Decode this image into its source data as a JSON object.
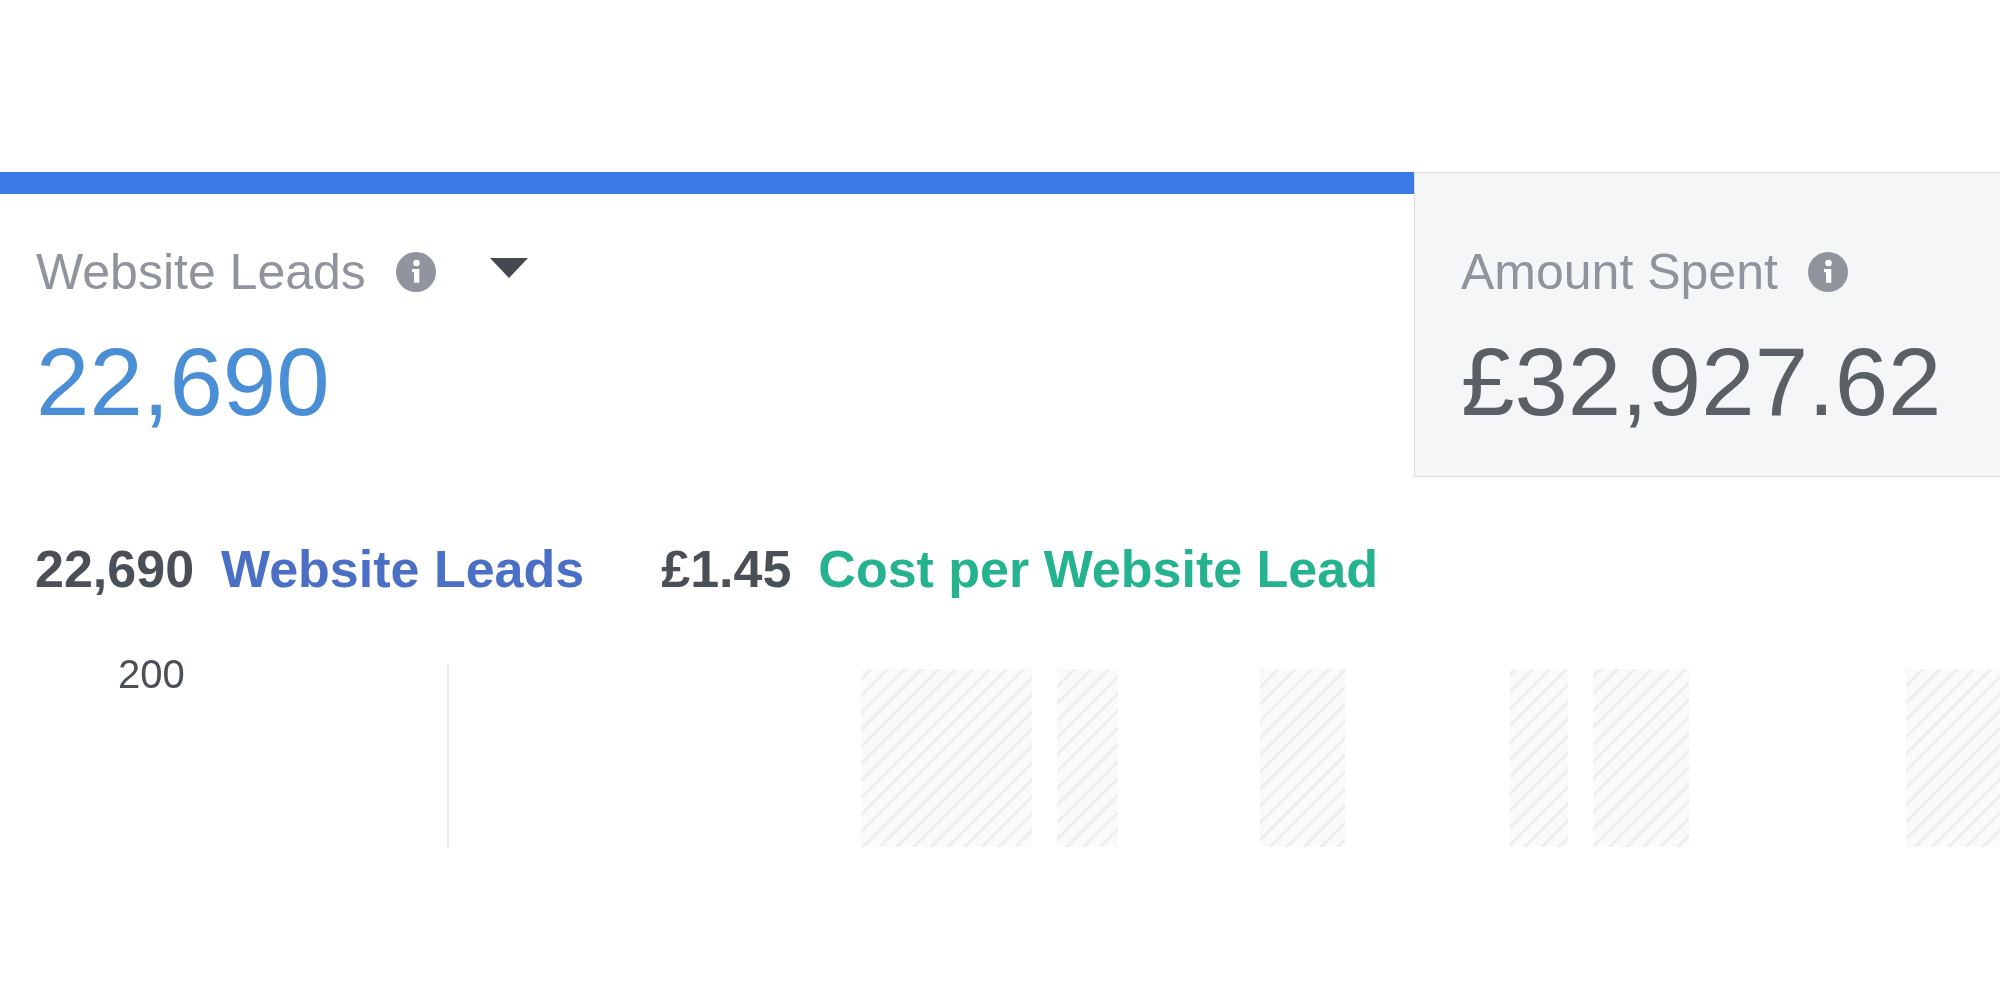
{
  "metric_tabs": [
    {
      "label": "Website Leads",
      "value": "22,690",
      "selected": true,
      "dropdown": true
    },
    {
      "label": "Amount Spent",
      "value": "£32,927.62",
      "selected": false,
      "dropdown": false
    }
  ],
  "summary": [
    {
      "amount": "22,690",
      "metric": "Website Leads",
      "color": "#4a6fc4"
    },
    {
      "amount": "£1.45",
      "metric": "Cost per Website Lead",
      "color": "#25b28f"
    }
  ],
  "chart": {
    "y_tick": "200"
  }
}
